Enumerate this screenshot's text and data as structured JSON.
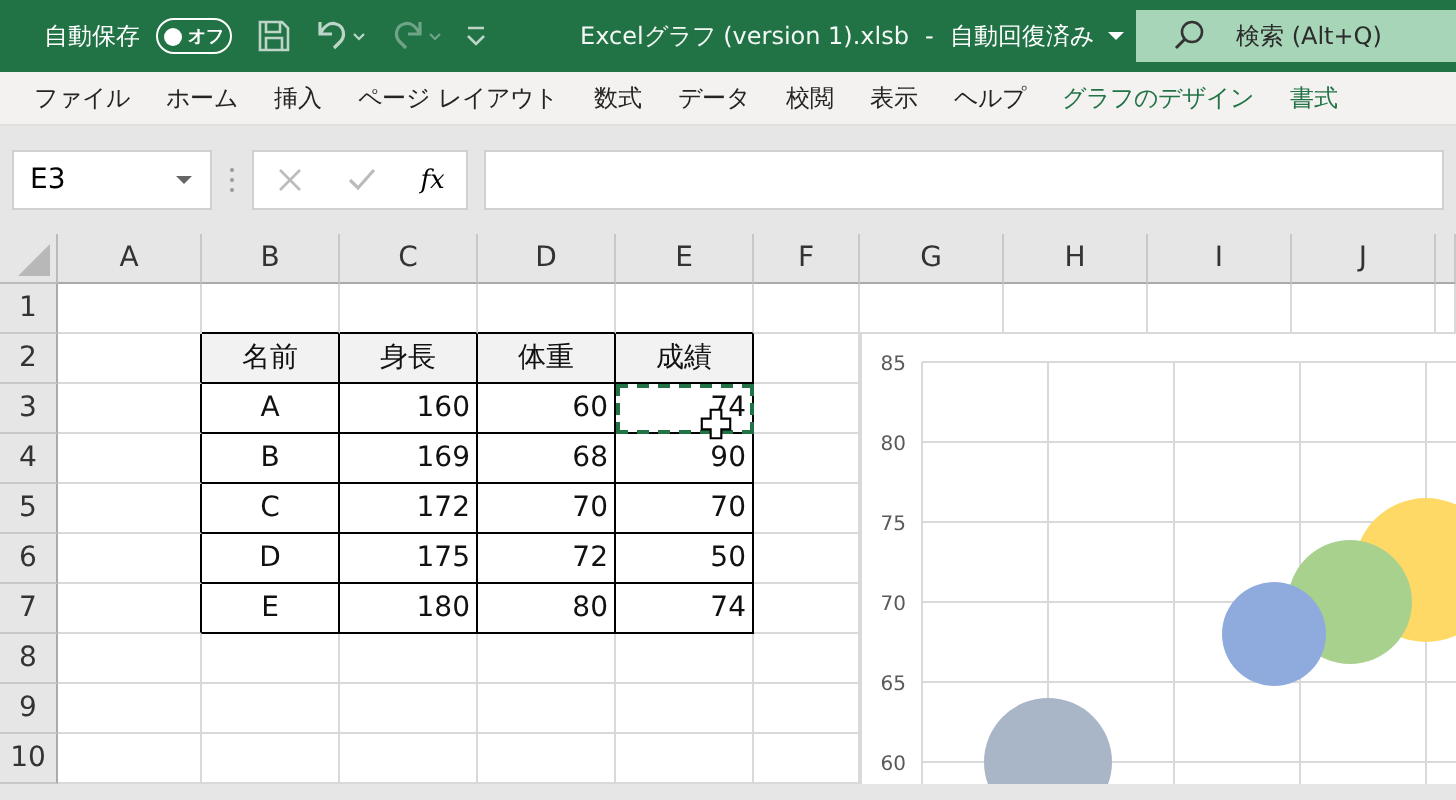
{
  "title_bar": {
    "autosave": {
      "label": "自動保存",
      "toggle_text": "オフ",
      "on": false
    },
    "quick_access": [
      {
        "kind": "save",
        "disabled": false
      },
      {
        "kind": "undo",
        "disabled": false
      },
      {
        "kind": "redo",
        "disabled": true
      },
      {
        "kind": "customize",
        "disabled": false
      }
    ],
    "file_name": "Excelグラフ (version 1).xlsb",
    "separator": "-",
    "save_status": "自動回復済み",
    "search": {
      "placeholder": "検索 (Alt+Q)"
    }
  },
  "ribbon_tabs": [
    {
      "label": "ファイル",
      "kind": "standard",
      "selected": false
    },
    {
      "label": "ホーム",
      "kind": "standard",
      "selected": false
    },
    {
      "label": "挿入",
      "kind": "standard",
      "selected": false
    },
    {
      "label": "ページ レイアウト",
      "kind": "standard",
      "selected": false
    },
    {
      "label": "数式",
      "kind": "standard",
      "selected": false
    },
    {
      "label": "データ",
      "kind": "standard",
      "selected": false
    },
    {
      "label": "校閲",
      "kind": "standard",
      "selected": false
    },
    {
      "label": "表示",
      "kind": "standard",
      "selected": false
    },
    {
      "label": "ヘルプ",
      "kind": "standard",
      "selected": false
    },
    {
      "label": "グラフのデザイン",
      "kind": "contextual",
      "selected": false
    },
    {
      "label": "書式",
      "kind": "contextual",
      "selected": false
    }
  ],
  "formula_bar": {
    "name_box": "E3",
    "function_label": "fx"
  },
  "sheet": {
    "columns": [
      "A",
      "B",
      "C",
      "D",
      "E",
      "F",
      "G",
      "H",
      "I",
      "J"
    ],
    "rows": [
      "1",
      "2",
      "3",
      "4",
      "5",
      "6",
      "7",
      "8",
      "9",
      "10"
    ],
    "table": {
      "columns": [
        "名前",
        "身長",
        "体重",
        "成績"
      ],
      "rows": [
        {
          "cells": [
            {
              "text": "A",
              "copied": false
            },
            {
              "text": "160",
              "copied": false
            },
            {
              "text": "60",
              "copied": false
            },
            {
              "text": "74",
              "copied": true
            }
          ]
        },
        {
          "cells": [
            {
              "text": "B",
              "copied": false
            },
            {
              "text": "169",
              "copied": false
            },
            {
              "text": "68",
              "copied": false
            },
            {
              "text": "90",
              "copied": false
            }
          ]
        },
        {
          "cells": [
            {
              "text": "C",
              "copied": false
            },
            {
              "text": "172",
              "copied": false
            },
            {
              "text": "70",
              "copied": false
            },
            {
              "text": "70",
              "copied": false
            }
          ]
        },
        {
          "cells": [
            {
              "text": "D",
              "copied": false
            },
            {
              "text": "175",
              "copied": false
            },
            {
              "text": "72",
              "copied": false
            },
            {
              "text": "50",
              "copied": false
            }
          ]
        },
        {
          "cells": [
            {
              "text": "E",
              "copied": false
            },
            {
              "text": "180",
              "copied": false
            },
            {
              "text": "80",
              "copied": false
            },
            {
              "text": "74",
              "copied": false
            }
          ]
        }
      ]
    }
  },
  "chart": {
    "y_axis_labels": [
      "85",
      "80",
      "75",
      "70",
      "65",
      "60"
    ]
  }
}
